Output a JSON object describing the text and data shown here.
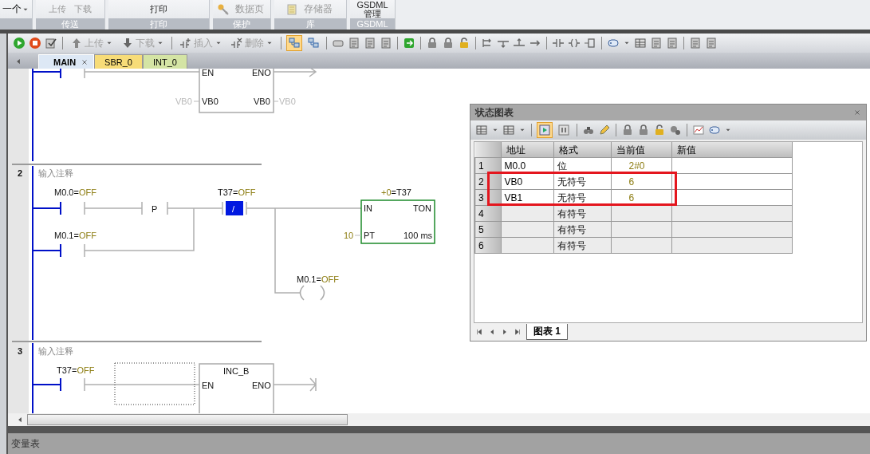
{
  "ribbon": {
    "first_item": {
      "label": "一个"
    },
    "groups": [
      {
        "kind": "split",
        "label": "传送",
        "items": [
          "上传",
          "下载"
        ]
      },
      {
        "kind": "plain",
        "label": "打印",
        "items": [
          "打印"
        ]
      },
      {
        "kind": "key",
        "label": "保护",
        "items": [
          "数据页"
        ]
      },
      {
        "kind": "memory",
        "label": "库",
        "items": [
          "存储器"
        ]
      },
      {
        "kind": "stack",
        "label": "GSDML",
        "items": [
          "GSDML",
          "管理"
        ]
      }
    ]
  },
  "toolbar": {
    "buttons": [
      {
        "kind": "up",
        "label": "上传",
        "disabled": true
      },
      {
        "kind": "down",
        "label": "下载",
        "disabled": true
      },
      {
        "kind": "insert",
        "label": "插入",
        "disabled": true
      },
      {
        "kind": "delete",
        "label": "删除",
        "disabled": true
      }
    ],
    "view_toggles": [
      {
        "selected": true
      },
      {
        "selected": false
      }
    ]
  },
  "editor_tabs": [
    {
      "label": "MAIN",
      "selected": true,
      "color": "#dde8f5"
    },
    {
      "label": "SBR_0",
      "selected": false,
      "color": "#f7dc78"
    },
    {
      "label": "INT_0",
      "selected": false,
      "color": "#d4e4a4"
    }
  ],
  "networks": [
    {
      "kind": "box_tail",
      "box": {
        "en": "EN",
        "eno": "ENO",
        "in_operand": "VB0",
        "in_pin": "VB0",
        "out_pin": "VB0",
        "out_operand": "VB0"
      }
    },
    {
      "kind": "timer",
      "number": "2",
      "comment": "输入注释",
      "contact_1": {
        "address": "M0.0=",
        "value": "OFF"
      },
      "edge": "P",
      "contact_2": {
        "address": "T37=",
        "value": "OFF",
        "symbol": "/",
        "selected": true
      },
      "contact_3": {
        "address": "M0.1=",
        "value": "OFF"
      },
      "timer": {
        "value": "+0",
        "name": "=T37",
        "in": "IN",
        "type": "TON",
        "preset": "10",
        "pt": "PT",
        "base": "100 ms"
      },
      "coil": {
        "address": "M0.1=",
        "value": "OFF"
      }
    },
    {
      "kind": "increment",
      "number": "3",
      "comment": "输入注释",
      "contact": {
        "address": "T37=",
        "value": "OFF"
      },
      "box": {
        "name": "INC_B",
        "en": "EN",
        "eno": "ENO"
      }
    }
  ],
  "status_chart": {
    "title": "状态图表",
    "toolbar_toggles": [
      {
        "selected": true
      },
      {
        "selected": false
      }
    ],
    "columns": [
      "地址",
      "格式",
      "当前值",
      "新值"
    ],
    "rows": [
      {
        "number": "1",
        "address": "M0.0",
        "format": "位",
        "current": "2#0"
      },
      {
        "number": "2",
        "address": "VB0",
        "format": "无符号",
        "current": "6"
      },
      {
        "number": "3",
        "address": "VB1",
        "format": "无符号",
        "current": "6"
      },
      {
        "number": "4",
        "format": "有符号"
      },
      {
        "number": "5",
        "format": "有符号"
      },
      {
        "number": "6",
        "format": "有符号"
      }
    ],
    "sheet_tabs": [
      {
        "label": "图表 1",
        "selected": true
      }
    ]
  },
  "bottom_panel": {
    "title": "变量表"
  }
}
